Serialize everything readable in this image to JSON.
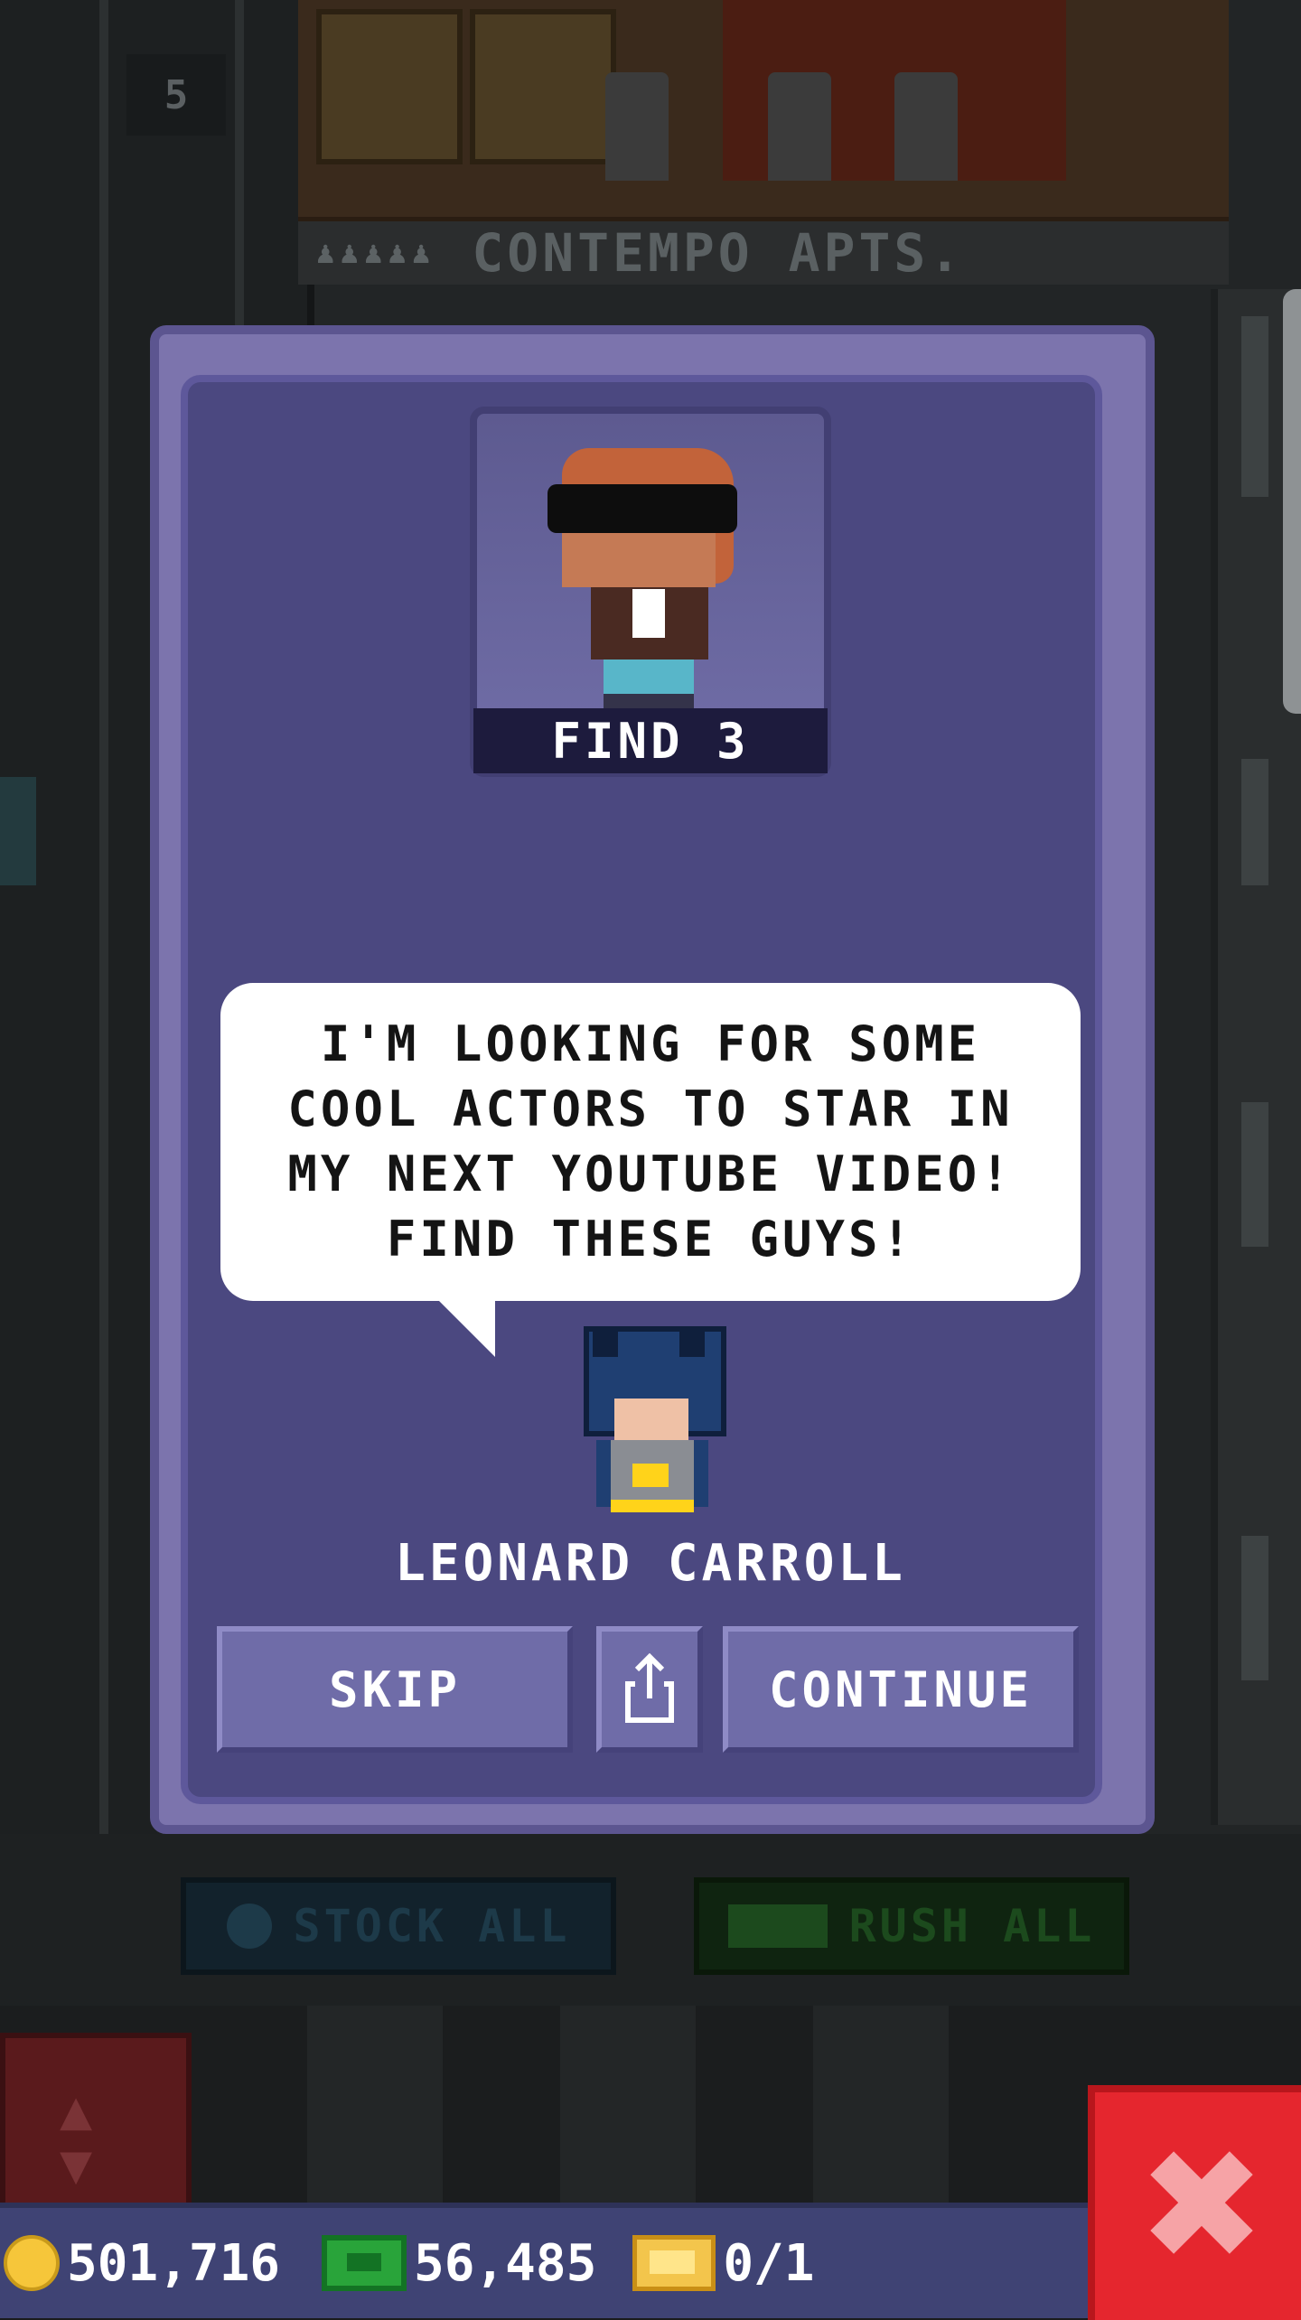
{
  "scene": {
    "floor_number": "5",
    "floor_name": "CONTEMPO APTS.",
    "resident_icons": "♟♟♟♟♟",
    "stock_all_label": "STOCK ALL",
    "rush_all_label": "RUSH ALL"
  },
  "mission": {
    "find_label": "FIND 3",
    "wanted_icon": "bitizen-sunglasses-icon",
    "message_lines": [
      "I'M LOOKING FOR SOME",
      "COOL ACTORS TO STAR IN",
      "MY NEXT YOUTUBE VIDEO!",
      "FIND THESE GUYS!"
    ],
    "npc_name": "LEONARD CARROLL",
    "npc_icon": "batman-bitizen-icon",
    "buttons": {
      "skip": "SKIP",
      "share_icon": "share-icon",
      "continue": "CONTINUE"
    }
  },
  "status_bar": {
    "coins": "501,716",
    "bux": "56,485",
    "tickets": "0/1"
  },
  "colors": {
    "modal_bg": "#4b4880",
    "modal_border": "#7c74ad",
    "status_bar": "#3f4374",
    "close_button": "#e5262e",
    "coin": "#f6c63a",
    "bux": "#29a43a"
  }
}
